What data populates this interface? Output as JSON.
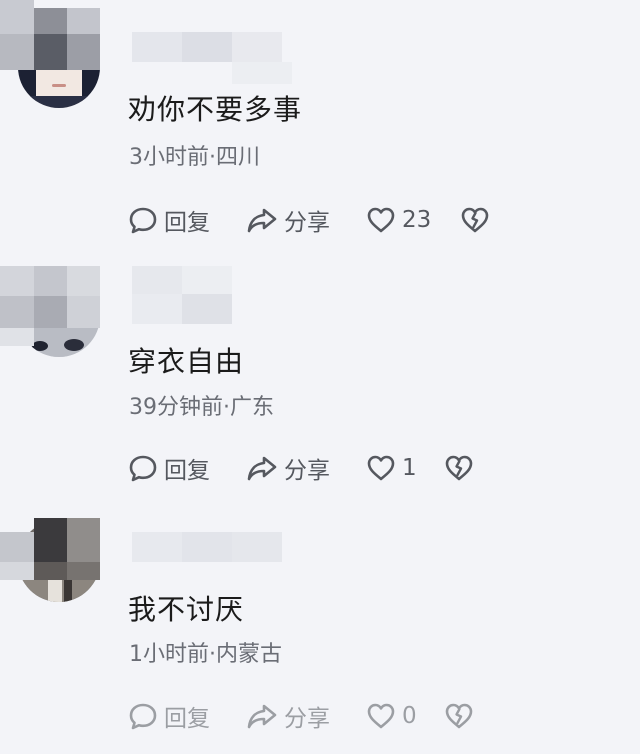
{
  "comments": [
    {
      "text": "劝你不要多事",
      "meta": "3小时前·四川",
      "reply_label": "回复",
      "share_label": "分享",
      "like_count": "23"
    },
    {
      "text": "穿衣自由",
      "meta": "39分钟前·广东",
      "reply_label": "回复",
      "share_label": "分享",
      "like_count": "1"
    },
    {
      "text": "我不讨厌",
      "meta": "1小时前·内蒙古",
      "reply_label": "回复",
      "share_label": "分享",
      "like_count": "0"
    }
  ],
  "icons": {
    "reply": "comment-bubble-icon",
    "share": "share-arrow-icon",
    "like": "heart-icon",
    "dislike": "broken-heart-icon"
  },
  "colors": {
    "background": "#f3f4f8",
    "text": "#1b1b1b",
    "meta": "#6a6d75",
    "action": "#55585f"
  }
}
